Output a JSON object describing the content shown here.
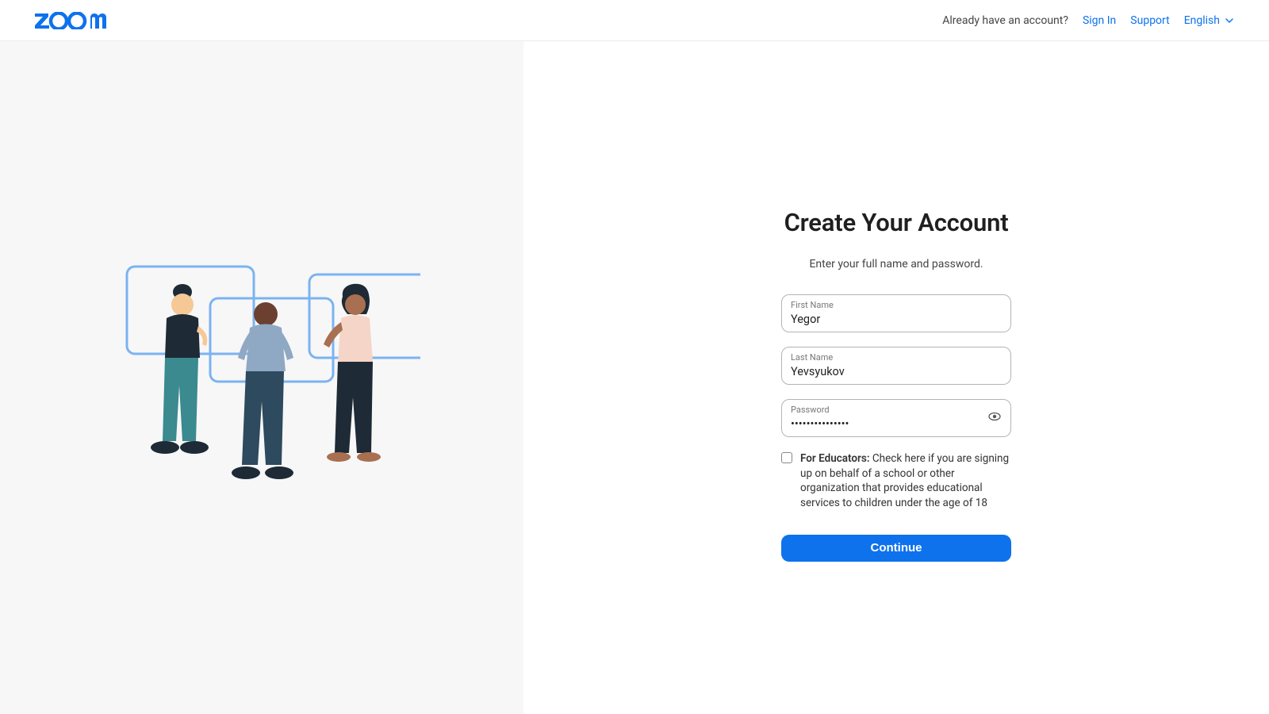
{
  "header": {
    "already_text": "Already have an account?",
    "sign_in": "Sign In",
    "support": "Support",
    "language": "English"
  },
  "form": {
    "title": "Create Your Account",
    "subtitle": "Enter your full name and password.",
    "first_name_label": "First Name",
    "first_name_value": "Yegor",
    "last_name_label": "Last Name",
    "last_name_value": "Yevsyukov",
    "password_label": "Password",
    "password_value": "•••••••••••••••",
    "educators_bold": "For Educators:",
    "educators_text": " Check here if you are signing up on behalf of a school or other organization that provides educational services to children under the age of 18",
    "continue_label": "Continue"
  }
}
